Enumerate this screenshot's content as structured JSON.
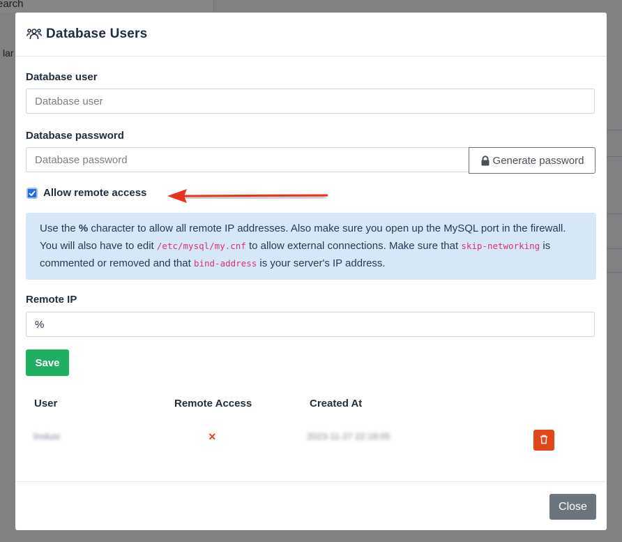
{
  "background": {
    "search_text": "earch",
    "partial_text": "lar"
  },
  "modal": {
    "icon": "users-icon",
    "title": "Database Users"
  },
  "form": {
    "user_label": "Database user",
    "user_placeholder": "Database user",
    "password_label": "Database password",
    "password_placeholder": "Database password",
    "generate_icon": "lock-icon",
    "generate_label": "Generate password",
    "remote_checkbox_checked": true,
    "remote_label": "Allow remote access",
    "remote_ip_label": "Remote IP",
    "remote_ip_value": "%",
    "save_label": "Save"
  },
  "info": {
    "t1": "Use the ",
    "percent": "%",
    "t2": " character to allow all remote IP addresses. Also make sure you open up the MySQL port in the firewall. You will also have to edit ",
    "path": "/etc/mysql/my.cnf",
    "t3": " to allow external connections. Make sure that ",
    "skip": "skip-networking",
    "t4": " is commented or removed and that ",
    "bind": "bind-address",
    "t5": " is your server's IP address."
  },
  "table": {
    "headers": [
      "User",
      "Remote Access",
      "Created At"
    ],
    "rows": [
      {
        "user": "lmdusr",
        "remote_access": "×",
        "created_at": "2023-11-27 22:18:05",
        "delete_icon": "trash-icon"
      }
    ]
  },
  "footer": {
    "close_label": "Close"
  },
  "colors": {
    "primary": "#2b6bd6",
    "success": "#1fae62",
    "danger": "#e0481b",
    "secondary": "#6c757d",
    "info_bg": "#d6e7f7",
    "arrow": "#e8341c"
  }
}
